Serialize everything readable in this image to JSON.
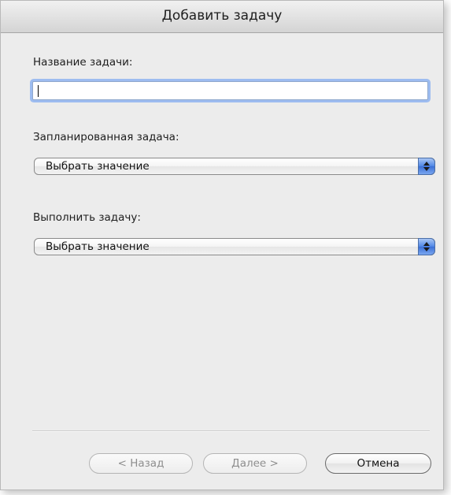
{
  "window": {
    "title": "Добавить задачу"
  },
  "task_name": {
    "label": "Название задачи:",
    "value": ""
  },
  "scheduled_task": {
    "label": "Запланированная задача:",
    "selected": "Выбрать значение"
  },
  "execute_task": {
    "label": "Выполнить задачу:",
    "selected": "Выбрать значение"
  },
  "buttons": {
    "back": "< Назад",
    "next": "Далее >",
    "cancel": "Отмена"
  },
  "colors": {
    "window_bg": "#ececec",
    "focus_ring": "#9dbcf0",
    "stepper_blue": "#4d85e6",
    "disabled_text": "#8e8e8e"
  }
}
